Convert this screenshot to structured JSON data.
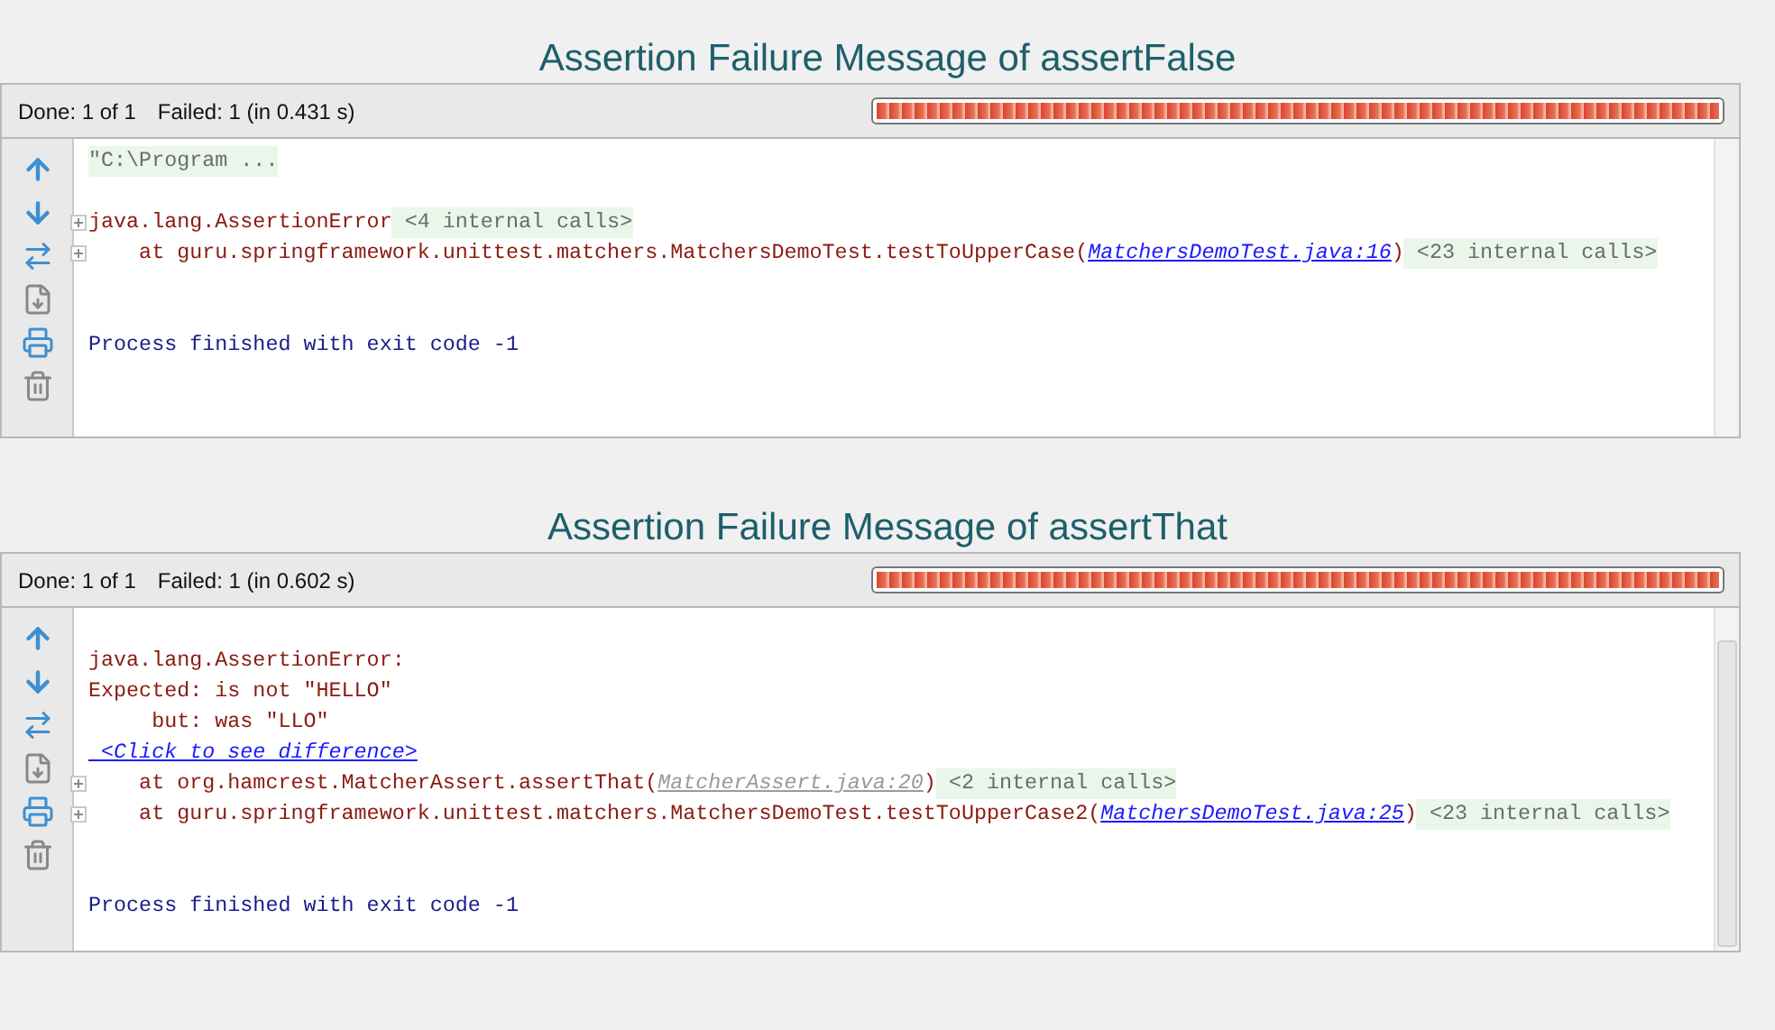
{
  "panels": [
    {
      "title": "Assertion Failure Message of assertFalse",
      "status": {
        "done": "Done: 1 of 1",
        "failed": "Failed: 1 (in 0.431 s)"
      },
      "progress": {
        "level": 1
      },
      "scrollbar_thumb": false,
      "lines": [
        {
          "kind": "text",
          "expander": false,
          "segments": [
            {
              "kind": "folded",
              "text": "\"C:\\Program ..."
            }
          ]
        },
        {
          "kind": "blank"
        },
        {
          "kind": "text",
          "expander": true,
          "segments": [
            {
              "kind": "error",
              "text": "java.lang.AssertionError"
            },
            {
              "kind": "folded",
              "text": " <4 internal calls>"
            }
          ]
        },
        {
          "kind": "text",
          "expander": true,
          "segments": [
            {
              "kind": "error",
              "text": "    at guru.springframework.unittest.matchers.MatchersDemoTest.testToUpperCase("
            },
            {
              "kind": "link",
              "text": "MatchersDemoTest.java:16"
            },
            {
              "kind": "error",
              "text": ")"
            },
            {
              "kind": "folded",
              "text": " <23 internal calls>"
            }
          ]
        },
        {
          "kind": "blank"
        },
        {
          "kind": "blank"
        },
        {
          "kind": "text",
          "expander": false,
          "segments": [
            {
              "kind": "system",
              "text": "Process finished with exit code -1"
            }
          ]
        }
      ]
    },
    {
      "title": "Assertion Failure Message of assertThat",
      "status": {
        "done": "Done: 1 of 1",
        "failed": "Failed: 1 (in 0.602 s)"
      },
      "progress": {
        "level": 1
      },
      "scrollbar_thumb": true,
      "lines": [
        {
          "kind": "blank"
        },
        {
          "kind": "text",
          "expander": false,
          "segments": [
            {
              "kind": "error",
              "text": "java.lang.AssertionError:"
            }
          ]
        },
        {
          "kind": "text",
          "expander": false,
          "segments": [
            {
              "kind": "error",
              "text": "Expected: is not \"HELLO\""
            }
          ]
        },
        {
          "kind": "text",
          "expander": false,
          "segments": [
            {
              "kind": "error",
              "text": "     but: was \"LLO\""
            }
          ]
        },
        {
          "kind": "text",
          "expander": false,
          "segments": [
            {
              "kind": "link",
              "text": " <Click to see difference>"
            }
          ]
        },
        {
          "kind": "text",
          "expander": true,
          "segments": [
            {
              "kind": "error",
              "text": "    at org.hamcrest.MatcherAssert.assertThat("
            },
            {
              "kind": "link_muted",
              "text": "MatcherAssert.java:20"
            },
            {
              "kind": "error",
              "text": ")"
            },
            {
              "kind": "folded",
              "text": " <2 internal calls>"
            }
          ]
        },
        {
          "kind": "text",
          "expander": true,
          "segments": [
            {
              "kind": "error",
              "text": "    at guru.springframework.unittest.matchers.MatchersDemoTest.testToUpperCase2("
            },
            {
              "kind": "link",
              "text": "MatchersDemoTest.java:25"
            },
            {
              "kind": "error",
              "text": ")"
            },
            {
              "kind": "folded",
              "text": " <23 internal calls>"
            }
          ]
        },
        {
          "kind": "blank"
        },
        {
          "kind": "blank"
        },
        {
          "kind": "text",
          "expander": false,
          "segments": [
            {
              "kind": "system",
              "text": "Process finished with exit code -1"
            }
          ]
        }
      ]
    }
  ]
}
